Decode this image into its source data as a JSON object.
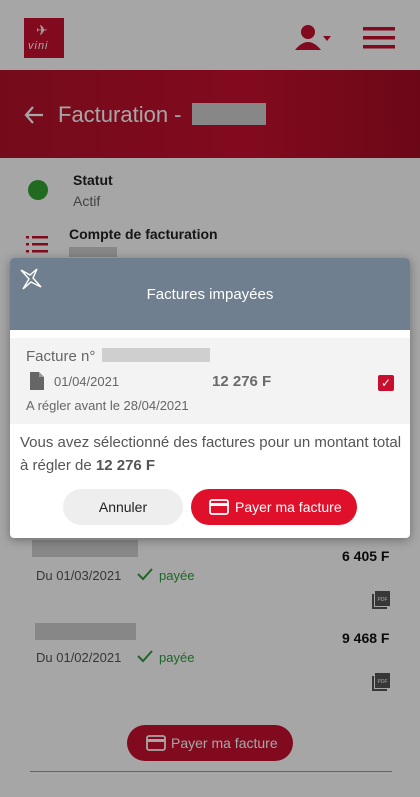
{
  "header": {
    "brand": "vini",
    "page_title": "Facturation -"
  },
  "account": {
    "status_label": "Statut",
    "status_value": "Actif",
    "billing_label": "Compte de facturation"
  },
  "invoices_list": [
    {
      "date_label": "Du 01/03/2021",
      "status": "payée",
      "amount": "6 405 F",
      "icon": "pdf-icon"
    },
    {
      "date_label": "Du 01/02/2021",
      "status": "payée",
      "amount": "9 468 F",
      "icon": "pdf-icon"
    }
  ],
  "bottom_button": {
    "label": "Payer ma facture"
  },
  "modal": {
    "title": "Factures impayées",
    "invoice": {
      "label": "Facture n°",
      "date": "01/04/2021",
      "amount": "12 276 F",
      "due": "A régler avant le 28/04/2021",
      "checked": true
    },
    "summary_text": "Vous avez sélectionné des factures pour un montant total à régler de",
    "summary_amount": "12 276 F",
    "cancel_label": "Annuler",
    "pay_label": "Payer ma facture"
  },
  "colors": {
    "brand_red": "#c8102e",
    "modal_header": "#6f7f8f",
    "paid_green": "#2e9e3c",
    "status_green": "#34a534"
  }
}
